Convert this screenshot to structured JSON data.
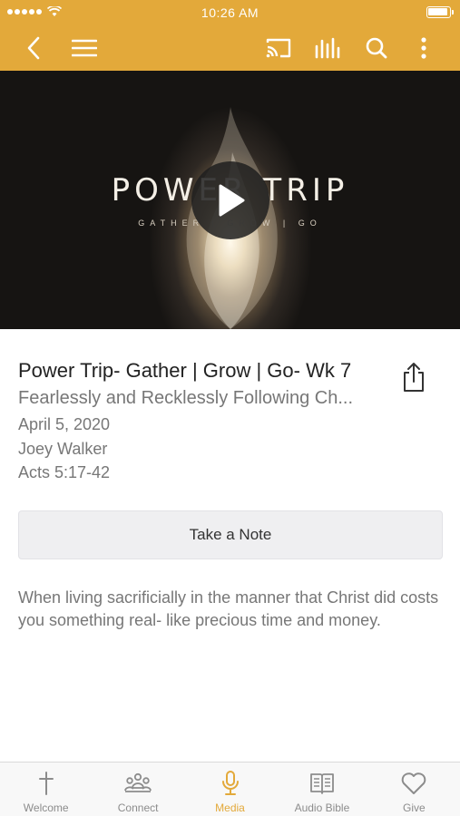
{
  "status_bar": {
    "time": "10:26 AM"
  },
  "nav_bar": {
    "icons": [
      "back-icon",
      "menu-icon",
      "cast-icon",
      "audio-bars-icon",
      "search-icon",
      "more-icon"
    ]
  },
  "hero": {
    "title": "POWER TRIP",
    "subtitle": "GATHER | GROW | GO"
  },
  "sermon": {
    "title": "Power Trip- Gather | Grow | Go- Wk 7",
    "subtitle": "Fearlessly and Recklessly Following Ch...",
    "date": "April 5, 2020",
    "speaker": "Joey Walker",
    "scripture": "Acts 5:17-42",
    "description": "When living sacrificially in the manner that Christ did costs you something real- like precious time and money."
  },
  "note_button": {
    "label": "Take a Note"
  },
  "tabs": [
    {
      "label": "Welcome",
      "icon": "cross-icon"
    },
    {
      "label": "Connect",
      "icon": "people-icon"
    },
    {
      "label": "Media",
      "icon": "microphone-icon"
    },
    {
      "label": "Audio Bible",
      "icon": "book-icon"
    },
    {
      "label": "Give",
      "icon": "heart-icon"
    }
  ],
  "colors": {
    "accent": "#e3a93a",
    "tab_inactive": "#8c8c8c"
  }
}
